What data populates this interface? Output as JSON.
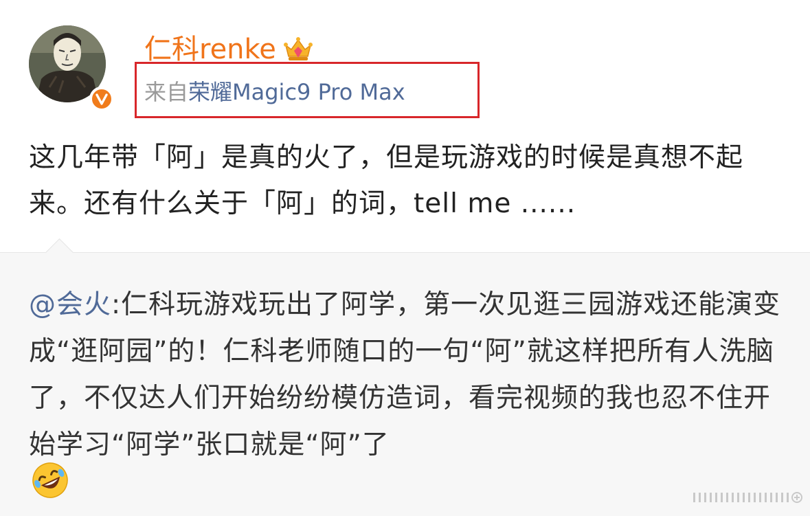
{
  "author": {
    "name": "仁科renke",
    "avatar_icon": "avatar-icon",
    "verified_icon": "verified-v-icon",
    "vip_icon": "vip-crown-icon"
  },
  "source": {
    "prefix": "来自",
    "device": "荣耀Magic9 Pro Max"
  },
  "post": {
    "text": "这几年带「阿」是真的火了，但是玩游戏的时候是真想不起来。还有什么关于「阿」的词，tell me ......"
  },
  "repost": {
    "mention": "@会火",
    "text": ":仁科玩游戏玩出了阿学，第一次见逛三园游戏还能演变成“逛阿园”的！仁科老师随口的一句“阿”就这样把所有人洗脑了，不仅达人们开始纷纷模仿造词，看完视频的我也忍不住开始学习“阿学”张口就是“阿”了",
    "emoji_icon": "rolling-laughing-emoji-icon"
  },
  "colors": {
    "username": "#f0741a",
    "source_highlight_border": "#d8262a",
    "link": "#506a98",
    "repost_bg": "#f7f7f7"
  }
}
